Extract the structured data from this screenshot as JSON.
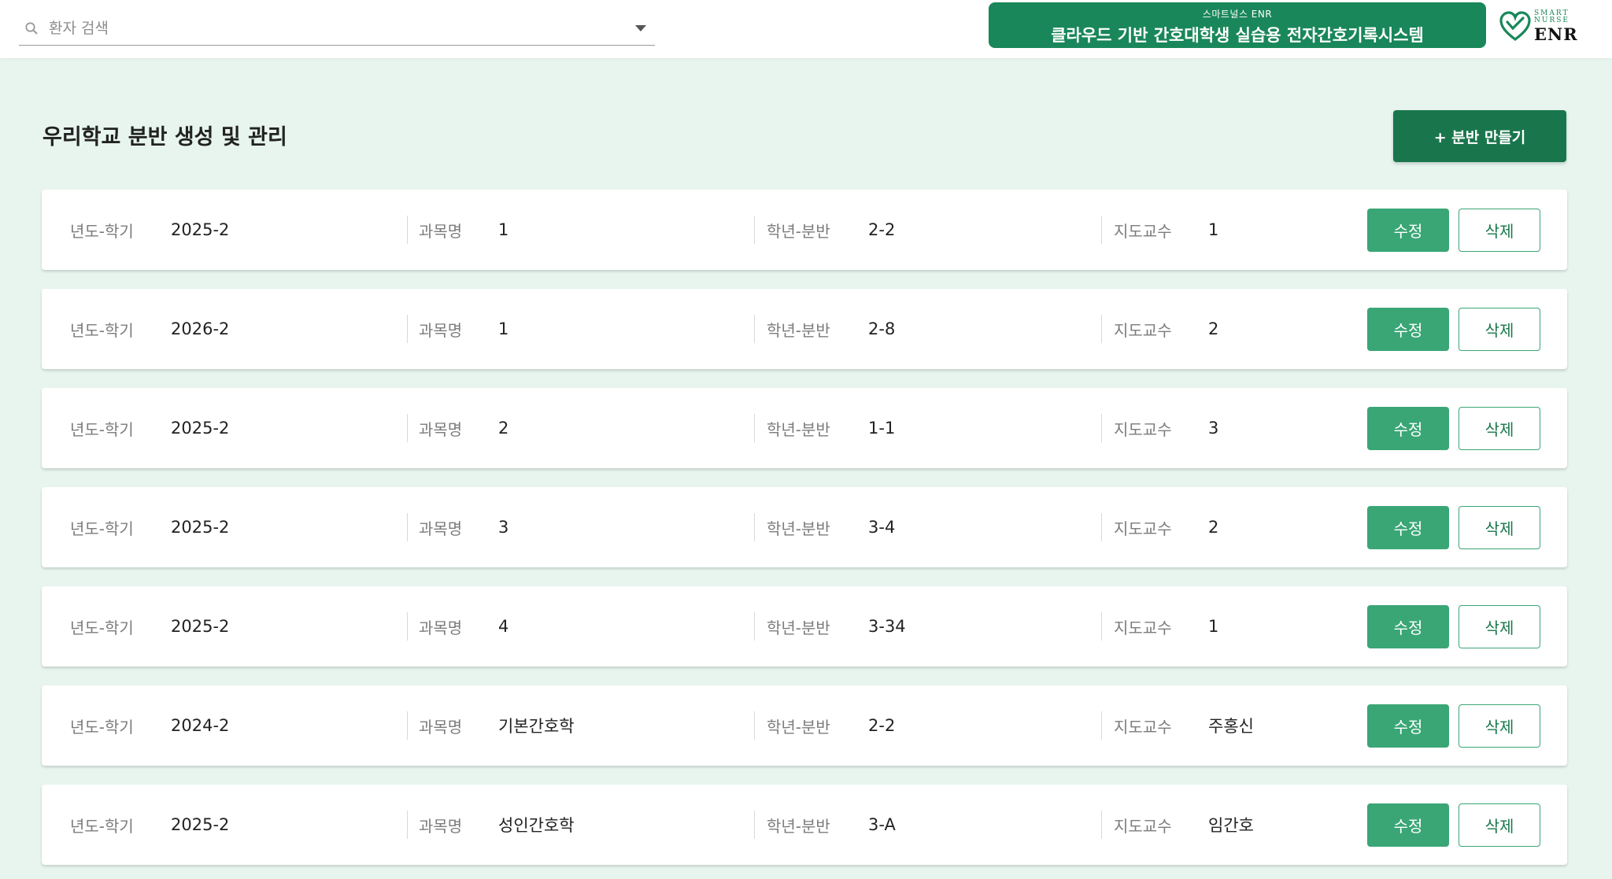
{
  "search": {
    "placeholder": "환자 검색"
  },
  "banner": {
    "subtitle": "스마트널스 ENR",
    "title": "클라우드 기반 간호대학생 실습용 전자간호기록시스템"
  },
  "logo": {
    "line1": "SMART",
    "line2": "NURSE",
    "wordmark": "ENR"
  },
  "section": {
    "title": "우리학교 분반 생성 및 관리",
    "create_label": "+ 분반 만들기"
  },
  "labels": {
    "term": "년도-학기",
    "subject": "과목명",
    "grade": "학년-분반",
    "professor": "지도교수",
    "edit": "수정",
    "delete": "삭제"
  },
  "classes": [
    {
      "term": "2025-2",
      "subject": "1",
      "grade": "2-2",
      "professor": "1"
    },
    {
      "term": "2026-2",
      "subject": "1",
      "grade": "2-8",
      "professor": "2"
    },
    {
      "term": "2025-2",
      "subject": "2",
      "grade": "1-1",
      "professor": "3"
    },
    {
      "term": "2025-2",
      "subject": "3",
      "grade": "3-4",
      "professor": "2"
    },
    {
      "term": "2025-2",
      "subject": "4",
      "grade": "3-34",
      "professor": "1"
    },
    {
      "term": "2024-2",
      "subject": "기본간호학",
      "grade": "2-2",
      "professor": "주홍신"
    },
    {
      "term": "2025-2",
      "subject": "성인간호학",
      "grade": "3-A",
      "professor": "임간호"
    }
  ],
  "colors": {
    "brand": "#19875a",
    "button_dark": "#19764c",
    "button_edit": "#3aa676",
    "background": "#e7f5ee"
  },
  "icons": {
    "search": "search-icon",
    "dropdown": "chevron-down-icon",
    "logo": "heart-logo-icon"
  }
}
